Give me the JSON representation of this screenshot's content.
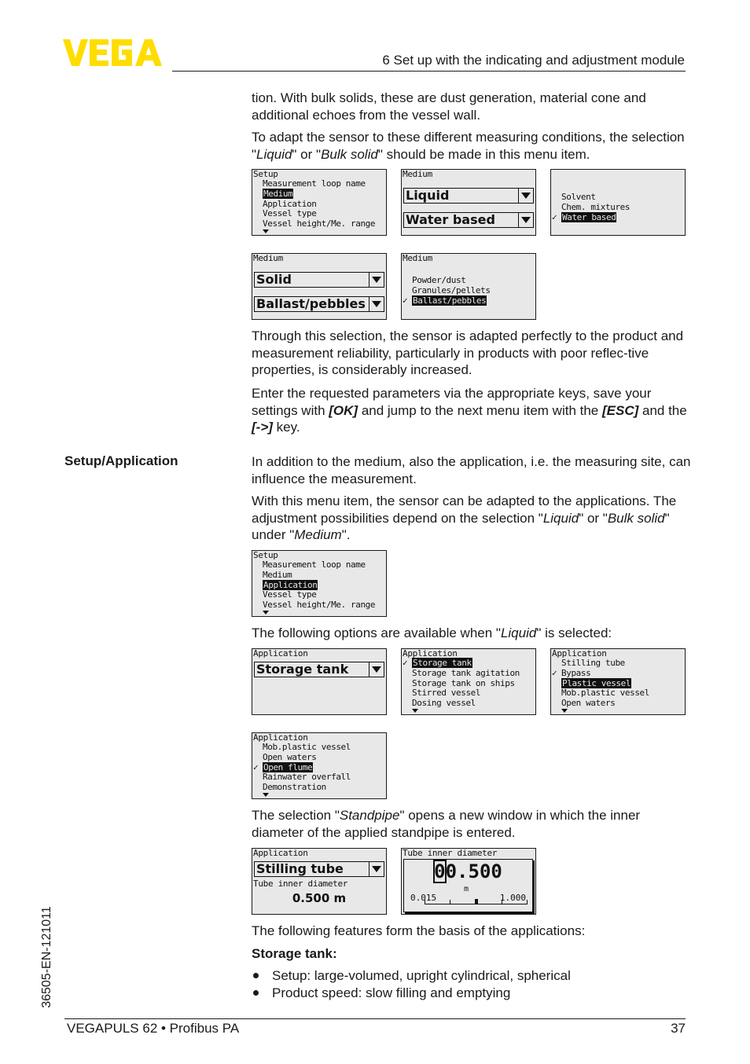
{
  "header": {
    "logo_text": "VEGA",
    "brand_color": "#FFDD00",
    "chapter_title": "6 Set up with the indicating and adjustment module"
  },
  "paragraphs": {
    "p1": "tion. With bulk solids, these are dust generation, material cone and additional echoes from the vessel wall.",
    "p2": {
      "before": "To adapt the sensor to these different measuring conditions, the selection \"",
      "em1": "Liquid",
      "mid": "\" or \"",
      "em2": "Bulk solid",
      "after": "\" should be made in this menu item."
    },
    "p3": "Through this selection, the sensor is adapted perfectly to the product and measurement reliability, particularly in products with poor reflec-tive properties, is considerably increased.",
    "p4": {
      "a": "Enter the requested parameters via the appropriate keys, save your settings with ",
      "k1": "[OK]",
      "b": " and jump to the next menu item with the ",
      "k2": "[ESC]",
      "c": " and the ",
      "k3": "[->]",
      "d": " key."
    },
    "section_heading": "Setup/Application",
    "p5": "In addition to the medium, also the application, i.e. the measuring site, can influence the measurement.",
    "p6": {
      "a": "With this menu item, the sensor can be adapted to the applications. The adjustment possibilities depend on the selection \"",
      "em1": "Liquid",
      "b": "\" or \"",
      "em2": "Bulk solid",
      "c": "\" under \"",
      "em3": "Medium",
      "d": "\"."
    },
    "p7": {
      "a": "The following options are available when \"",
      "em1": "Liquid",
      "b": "\" is selected:"
    },
    "p8": {
      "a": "The selection \"",
      "em1": "Standpipe",
      "b": "\" opens a new window in which the inner diameter of the applied standpipe is entered."
    },
    "p9": "The following features form the basis of the applications:",
    "sub_heading": "Storage tank:",
    "bullets": [
      "Setup: large-volumed, upright cylindrical, spherical",
      "Product speed: slow filling and emptying"
    ]
  },
  "screens": {
    "setup_medium": {
      "title": "Setup",
      "items": [
        "Measurement loop name",
        "Medium",
        "Application",
        "Vessel type",
        "Vessel height/Me. range"
      ],
      "selected_index": 1
    },
    "medium_liquid": {
      "title": "Medium",
      "dropdown1": "Liquid",
      "dropdown2": "Water based"
    },
    "liquid_list": {
      "items": [
        "Solvent",
        "Chem. mixtures",
        "Water based"
      ],
      "checked_index": 2,
      "selected_index": 2
    },
    "medium_solid": {
      "title": "Medium",
      "dropdown1": "Solid",
      "dropdown2": "Ballast/pebbles"
    },
    "solid_list": {
      "title": "Medium",
      "items": [
        "Powder/dust",
        "Granules/pellets",
        "Ballast/pebbles"
      ],
      "checked_index": 2,
      "selected_index": 2
    },
    "setup_application": {
      "title": "Setup",
      "items": [
        "Measurement loop name",
        "Medium",
        "Application",
        "Vessel type",
        "Vessel height/Me. range"
      ],
      "selected_index": 2
    },
    "application_dropdown": {
      "title": "Application",
      "dropdown1": "Storage tank"
    },
    "application_list1": {
      "title": "Application",
      "items": [
        "Storage tank",
        "Storage tank agitation",
        "Storage tank on ships",
        "Stirred vessel",
        "Dosing vessel"
      ],
      "checked_index": 0,
      "selected_index": 0
    },
    "application_list2": {
      "title": "Application",
      "items": [
        "Stilling tube",
        "Bypass",
        "Plastic vessel",
        "Mob.plastic vessel",
        "Open waters"
      ],
      "checked_index": 1,
      "selected_index": 2
    },
    "application_list3": {
      "title": "Application",
      "items": [
        "Mob.plastic vessel",
        "Open waters",
        "Open flume",
        "Rainwater overfall",
        "Demonstration"
      ],
      "checked_index": 2,
      "selected_index": 2
    },
    "stilling_tube": {
      "title": "Application",
      "dropdown1": "Stilling tube",
      "sublabel": "Tube inner diameter",
      "value": "0.500 m"
    },
    "tube_diameter_edit": {
      "title": "Tube inner diameter",
      "cursor_digit": "0",
      "value_rest": "0.500",
      "unit": "m",
      "range_min": "0.015",
      "range_max": "1.000"
    }
  },
  "side_code": "36505-EN-121011",
  "footer": {
    "product": "VEGAPULS 62 • Profibus PA",
    "page_number": "37"
  }
}
